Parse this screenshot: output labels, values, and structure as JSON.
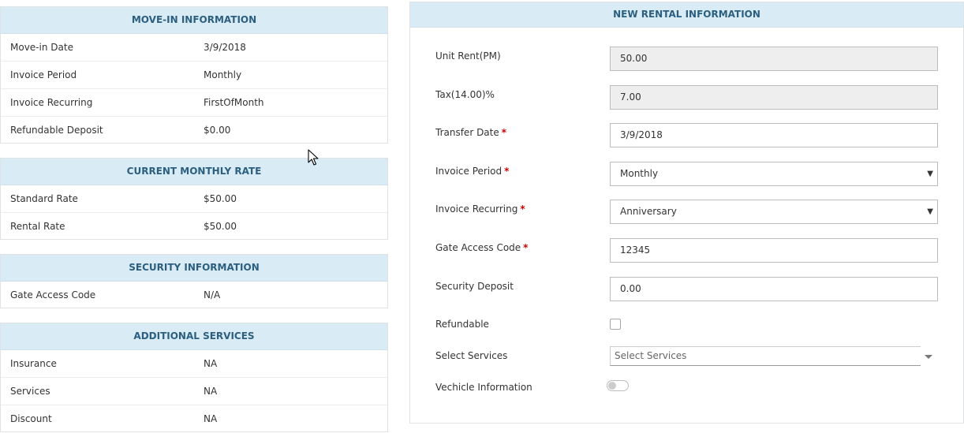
{
  "move_in": {
    "title": "MOVE-IN INFORMATION",
    "rows": [
      {
        "label": "Move-in Date",
        "value": "3/9/2018"
      },
      {
        "label": "Invoice Period",
        "value": "Monthly"
      },
      {
        "label": "Invoice Recurring",
        "value": "FirstOfMonth"
      },
      {
        "label": "Refundable Deposit",
        "value": "$0.00"
      }
    ]
  },
  "current_rate": {
    "title": "CURRENT MONTHLY RATE",
    "rows": [
      {
        "label": "Standard Rate",
        "value": "$50.00"
      },
      {
        "label": "Rental Rate",
        "value": "$50.00"
      }
    ]
  },
  "security": {
    "title": "SECURITY INFORMATION",
    "rows": [
      {
        "label": "Gate Access Code",
        "value": "N/A"
      }
    ]
  },
  "additional": {
    "title": "ADDITIONAL SERVICES",
    "rows": [
      {
        "label": "Insurance",
        "value": "NA"
      },
      {
        "label": "Services",
        "value": "NA"
      },
      {
        "label": "Discount",
        "value": "NA"
      }
    ]
  },
  "new_rental": {
    "title": "NEW RENTAL INFORMATION",
    "unit_rent": {
      "label": "Unit Rent(PM)",
      "value": "50.00"
    },
    "tax": {
      "label": "Tax(14.00)%",
      "value": "7.00"
    },
    "transfer_date": {
      "label": "Transfer Date",
      "value": "3/9/2018"
    },
    "invoice_period": {
      "label": "Invoice Period",
      "value": "Monthly"
    },
    "invoice_recurring": {
      "label": "Invoice Recurring",
      "value": "Anniversary"
    },
    "gate_code": {
      "label": "Gate Access Code",
      "value": "12345"
    },
    "security_deposit": {
      "label": "Security Deposit",
      "value": "0.00"
    },
    "refundable": {
      "label": "Refundable",
      "checked": false
    },
    "services": {
      "label": "Select Services",
      "placeholder": "Select Services"
    },
    "vehicle": {
      "label": "Vechicle Information",
      "enabled": false
    }
  },
  "required_marker": "*",
  "icons": {
    "select_caret": "▼"
  },
  "colors": {
    "header_bg": "#d9ecf5",
    "header_text": "#2c5f7f",
    "required": "#cc0000",
    "readonly_bg": "#eeeeee"
  }
}
